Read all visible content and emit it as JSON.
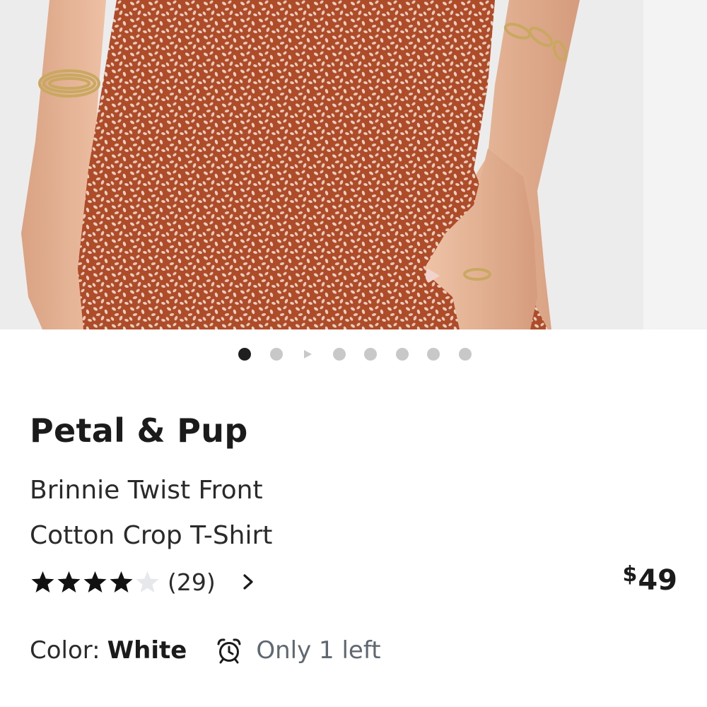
{
  "gallery": {
    "image_description_icon": "product-photo",
    "dot_count": 8,
    "active_index": 0,
    "video_index": 2
  },
  "product": {
    "brand": "Petal & Pup",
    "title_line1": "Brinnie Twist Front",
    "title_line2": "Cotton Crop T-Shirt",
    "rating": 4,
    "rating_max": 5,
    "review_count": "(29)",
    "price_currency": "$",
    "price_amount": "49",
    "color_label": "Color:",
    "color_value": "White",
    "stock_text": "Only 1 left"
  },
  "colors": {
    "fabric": "#b24f2c",
    "fabric_dark": "#9a4226",
    "skin": "#e8b596",
    "dot_active": "#1f1f1f",
    "dot_inactive": "#c8c8c8",
    "star_filled": "#111111",
    "star_empty": "#e6e8eb",
    "stock_text": "#5f6770"
  },
  "icons": {
    "chevron": "chevron-right-icon",
    "clock": "alarm-clock-icon"
  }
}
